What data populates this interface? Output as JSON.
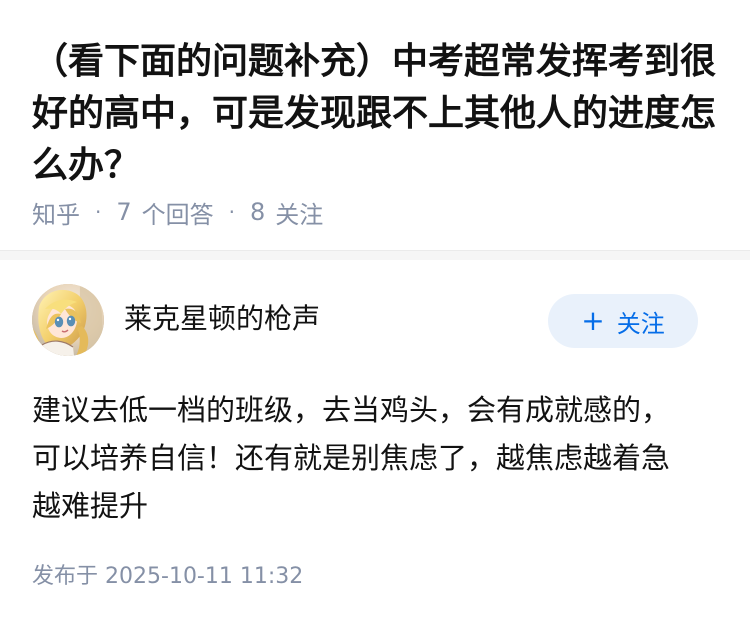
{
  "question": {
    "title": "（看下面的问题补充）中考超常发挥考到很好的高中，可是发现跟不上其他人的进度怎么办？",
    "source": "知乎",
    "answer_count": "7",
    "answer_label": "个回答",
    "follower_count": "8",
    "follower_label": "关注"
  },
  "answer": {
    "author_name": "莱克星顿的枪声",
    "avatar_icon": "anime-girl-avatar-icon",
    "follow_symbol": "+",
    "follow_label": "关注",
    "body": "建议去低一档的班级，去当鸡头，会有成就感的，\n可以培养自信！还有就是别焦虑了，越焦虑越着急\n越难提升",
    "published_label": "发布于",
    "published_time": "2025-10-11 11:32"
  },
  "colors": {
    "text": "#121212",
    "muted": "#8590a6",
    "brand": "#056de8",
    "follow_background": "#e9f1fb",
    "divider": "#f6f6f6"
  }
}
